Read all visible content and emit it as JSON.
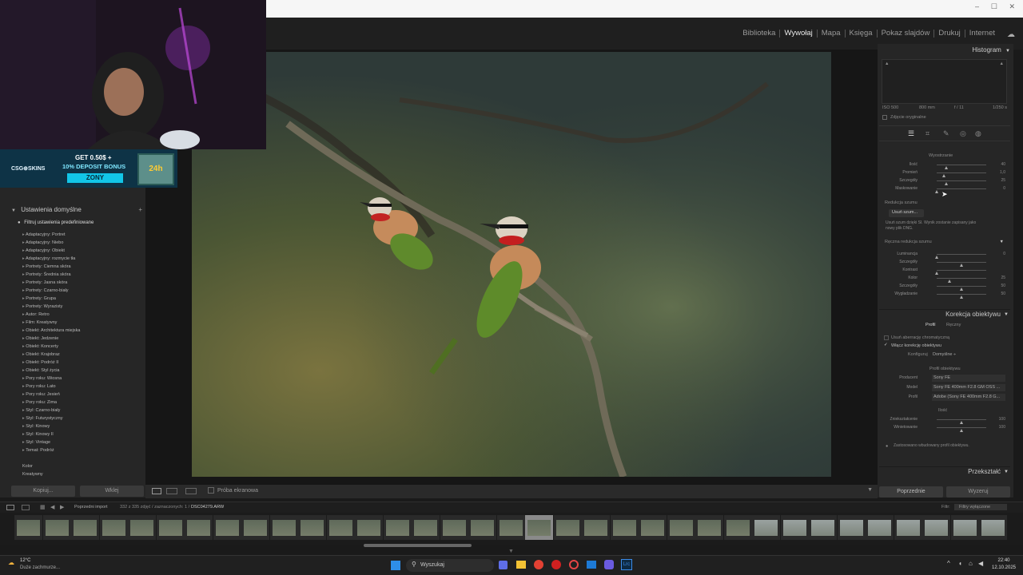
{
  "window": {
    "controls": [
      "–",
      "☐",
      "✕"
    ]
  },
  "modules": [
    {
      "label": "Biblioteka",
      "active": false
    },
    {
      "label": "Wywołaj",
      "active": true
    },
    {
      "label": "Mapa",
      "active": false
    },
    {
      "label": "Księga",
      "active": false
    },
    {
      "label": "Pokaz slajdów",
      "active": false
    },
    {
      "label": "Drukuj",
      "active": false
    },
    {
      "label": "Internet",
      "active": false
    }
  ],
  "overlay": {
    "banner": {
      "brand": "CSG⊕SKINS",
      "line1": "GET 0.50$ +",
      "line2": "10% DEPOSIT BONUS",
      "cta": "ZONY",
      "badge": "24h"
    }
  },
  "left_panel": {
    "presets_title": "Ustawienia domyślne",
    "filter_label": "Filtruj ustawienia predefiniowane",
    "presets": [
      "Adaptacyjny: Portret",
      "Adaptacyjny: Niebo",
      "Adaptacyjny: Obiekt",
      "Adaptacyjny: rozmycie tła",
      "Portrety: Ciemna skóra",
      "Portrety: Średnia skóra",
      "Portrety: Jasna skóra",
      "Portrety: Czarno-biały",
      "Portrety: Grupa",
      "Portrety: Wyrazisty",
      "Autor: Retro",
      "Film: Kreatywny",
      "Obiekt: Architektura miejska",
      "Obiekt: Jedzenie",
      "Obiekt: Koncerty",
      "Obiekt: Krajobraz",
      "Obiekt: Podróż II",
      "Obiekt: Styl życia",
      "Pory roku: Wiosna",
      "Pory roku: Lato",
      "Pory roku: Jesień",
      "Pory roku: Zima",
      "Styl: Czarno-biały",
      "Styl: Futurystyczny",
      "Styl: Kinowy",
      "Styl: Kinowy II",
      "Styl: Vintage",
      "Temat: Podróż"
    ],
    "extra_presets": [
      "Kolor",
      "Kreatywny"
    ],
    "copy_button": "Kopiuj...",
    "paste_button": "Wklej"
  },
  "toolbar": {
    "soft_proof": "Próba ekranowa"
  },
  "right_panel": {
    "histogram_title": "Histogram",
    "histogram_info": [
      "ISO 500",
      "800 mm",
      "f / 11",
      "1/250 s"
    ],
    "original_checkbox": "Zdjęcie oryginalne",
    "sharpening_title": "Wyostrzanie",
    "sharpening": [
      {
        "label": "Ilość",
        "value": "40",
        "pos": 0.2
      },
      {
        "label": "Promień",
        "value": "1,0",
        "pos": 0.15
      },
      {
        "label": "Szczegóły",
        "value": "25",
        "pos": 0.2
      },
      {
        "label": "Maskowanie",
        "value": "0",
        "pos": 0.0
      }
    ],
    "noise_title": "Redukcja szumu",
    "denoise_button": "Usuń szum...",
    "denoise_note": "Usuń szum dzięki SI. Wynik zostanie zapisany jako nowy plik DNG.",
    "manual_noise": "Ręczna redukcja szumu",
    "noise_sliders": [
      {
        "label": "Luminancja",
        "value": "0",
        "pos": 0.0
      },
      {
        "label": "Szczegóły",
        "value": "",
        "pos": 0.5
      },
      {
        "label": "Kontrast",
        "value": "",
        "pos": 0.0
      },
      {
        "label": "Kolor",
        "value": "25",
        "pos": 0.25
      },
      {
        "label": "Szczegóły",
        "value": "50",
        "pos": 0.5
      },
      {
        "label": "Wygładzanie",
        "value": "50",
        "pos": 0.5
      }
    ],
    "lens_title": "Korekcja obiektywu",
    "lens_tabs": [
      "Profil",
      "Ręczny"
    ],
    "lens_checks": [
      {
        "label": "Usuń aberrację chromatyczną",
        "checked": false
      },
      {
        "label": "Włącz korekcję obiektywu",
        "checked": true
      }
    ],
    "setup_label": "Konfiguruj",
    "setup_value": "Domyślne ÷",
    "lens_profile_title": "Profil obiektywu",
    "lens_fields": [
      {
        "label": "Producent",
        "value": "Sony FE"
      },
      {
        "label": "Model",
        "value": "Sony FE 400mm F2.8 GM OSS ..."
      },
      {
        "label": "Profil",
        "value": "Adobe (Sony FE 400mm F2.8 G..."
      }
    ],
    "amount_title": "Ilość",
    "amount_sliders": [
      {
        "label": "Zniekształcenie",
        "value": "100",
        "pos": 0.5
      },
      {
        "label": "Winietowanie",
        "value": "100",
        "pos": 0.5
      }
    ],
    "builtin_note": "Zastosowano wbudowany profil obiektywu.",
    "transform_title": "Przekształć",
    "prev_button": "Poprzednie",
    "reset_button": "Wyzeruj"
  },
  "filmbar": {
    "source": "Poprzedni import",
    "count": "332 z 335 zdjęć / zaznaczonych: 1 /",
    "filename": "DSC04279.ARW",
    "filter_label": "Filtr:",
    "filter_value": "Filtry wyłączone"
  },
  "taskbar": {
    "weather_temp": "12°C",
    "weather_desc": "Duże zachmurze...",
    "search": "Wyszukaj",
    "time": "22:40",
    "date": "12.10.2025"
  }
}
